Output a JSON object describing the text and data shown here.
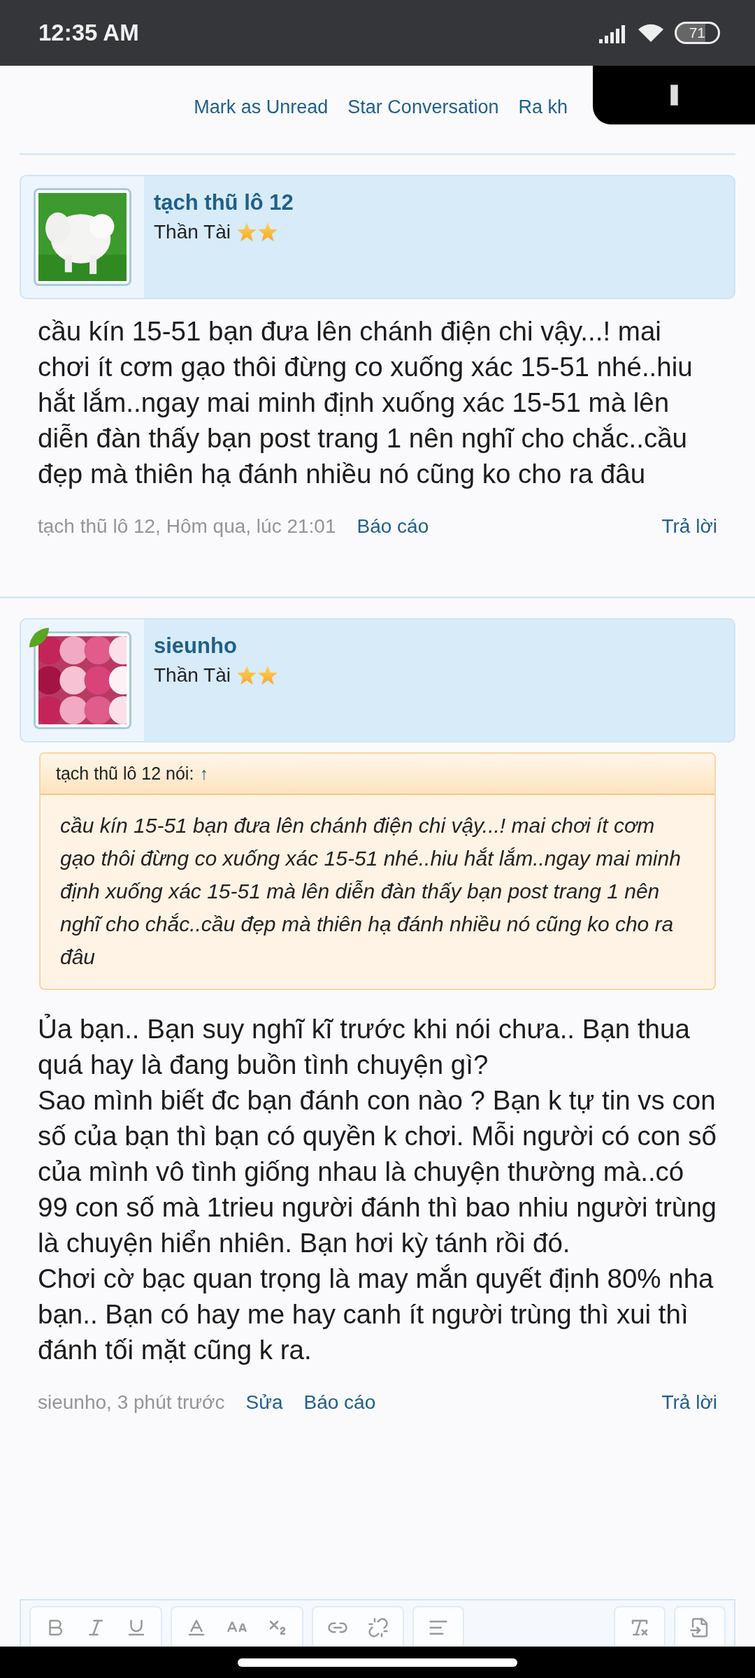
{
  "status_bar": {
    "time": "12:35 AM",
    "battery": "71"
  },
  "top_links": [
    "Mark as Unread",
    "Star Conversation",
    "Ra kh"
  ],
  "posts": [
    {
      "author": "tạch thũ lô 12",
      "rank": "Thần Tài",
      "online": false,
      "avatar": {
        "kind": "picture"
      },
      "paragraphs": [
        "cầu kín 15-51 bạn đưa lên chánh điện chi vậy...! mai chơi ít cơm gạo thôi đừng co xuống xác 15-51 nhé..hiu hắt lắm..ngay mai minh định xuống xác 15-51 mà lên diễn đàn thấy bạn post trang 1 nên nghĩ cho chắc..cầu đẹp mà thiên hạ đánh nhiều nó cũng ko cho ra đâu"
      ],
      "meta": "tạch thũ lô 12, Hôm qua, lúc 21:01",
      "actions": [
        "Báo cáo"
      ],
      "reply": "Trả lời"
    },
    {
      "author": "sieunho",
      "rank": "Thần Tài",
      "online": true,
      "avatar": {
        "kind": "picture"
      },
      "quote": {
        "header": "tạch thũ lô 12 nói:",
        "arrow": "↑",
        "text": "cầu kín 15-51 bạn đưa lên chánh điện chi vậy...! mai chơi ít cơm gạo thôi đừng co xuống xác 15-51 nhé..hiu hắt lắm..ngay mai minh định xuống xác 15-51 mà lên diễn đàn thấy bạn post trang 1 nên nghĩ cho chắc..cầu đẹp mà thiên hạ đánh nhiều nó cũng ko cho ra đâu"
      },
      "paragraphs": [
        "Ủa bạn.. Bạn suy nghĩ kĩ trước khi nói chưa.. Bạn thua quá hay là đang buồn tình chuyện gì?",
        "Sao mình biết đc bạn đánh con nào ? Bạn k tự tin vs con số của bạn thì bạn có quyền k chơi. Mỗi người có con số của mình vô tình giống nhau là chuyện thường mà..có 99 con số mà 1trieu người đánh thì bao nhiu người trùng là chuyện hiển nhiên. Bạn hơi kỳ tánh rồi đó.",
        "Chơi cờ bạc quan trọng là may mắn quyết định 80% nha bạn.. Bạn có hay me hay canh ít người trùng thì xui thì đánh tối mặt cũng k ra."
      ],
      "meta": "sieunho, 3 phút trước",
      "actions": [
        "Sửa",
        "Báo cáo"
      ],
      "reply": "Trả lời"
    }
  ]
}
